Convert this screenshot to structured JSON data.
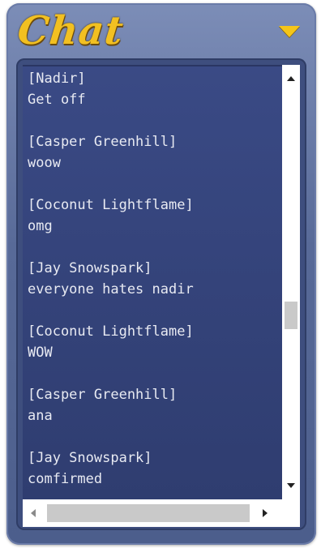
{
  "header": {
    "title": "Chat",
    "toggle_icon": "triangle-down-icon",
    "accent_color": "#f2c021"
  },
  "chat": {
    "messages": [
      {
        "author": "[Nadir]",
        "text": "Get off"
      },
      {
        "author": "[Casper Greenhill]",
        "text": "woow"
      },
      {
        "author": "[Coconut Lightflame]",
        "text": "omg"
      },
      {
        "author": "[Jay Snowspark]",
        "text": "everyone hates nadir"
      },
      {
        "author": "[Coconut Lightflame]",
        "text": "WOW"
      },
      {
        "author": "[Casper Greenhill]",
        "text": "ana"
      },
      {
        "author": "[Jay Snowspark]",
        "text": "comfirmed"
      }
    ]
  },
  "scrollbars": {
    "vertical_icons": [
      "arrow-up-icon",
      "arrow-down-icon"
    ],
    "horizontal_icons": [
      "arrow-left-icon",
      "arrow-right-icon"
    ]
  }
}
